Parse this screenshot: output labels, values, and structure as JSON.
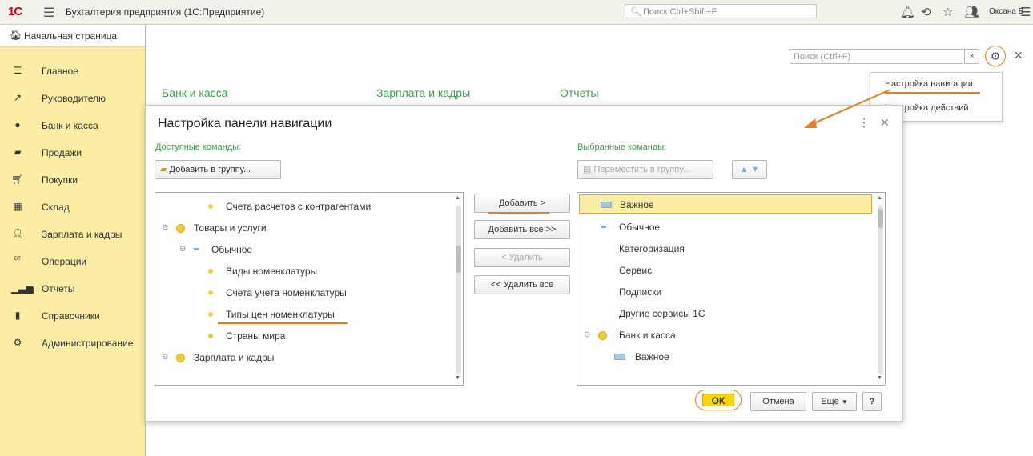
{
  "app": {
    "title": "Бухгалтерия предприятия (1С:Предприятие)",
    "logo": "1С",
    "global_search_placeholder": "Поиск Ctrl+Shift+F",
    "user_name": "Оксана В"
  },
  "sidebar": {
    "home_label": "Начальная страница",
    "items": [
      {
        "label": "Главное",
        "icon": "menu-lines-icon"
      },
      {
        "label": "Руководителю",
        "icon": "chart-line-icon"
      },
      {
        "label": "Банк и касса",
        "icon": "coin-icon"
      },
      {
        "label": "Продажи",
        "icon": "bag-icon"
      },
      {
        "label": "Покупки",
        "icon": "cart-icon"
      },
      {
        "label": "Склад",
        "icon": "warehouse-icon"
      },
      {
        "label": "Зарплата и кадры",
        "icon": "person-icon"
      },
      {
        "label": "Операции",
        "icon": "operations-icon"
      },
      {
        "label": "Отчеты",
        "icon": "bar-chart-icon"
      },
      {
        "label": "Справочники",
        "icon": "book-icon"
      },
      {
        "label": "Администрирование",
        "icon": "gear-icon"
      }
    ]
  },
  "main": {
    "search_placeholder": "Поиск (Ctrl+F)",
    "clear_label": "×",
    "sections": [
      "Банк и касса",
      "Зарплата и кадры",
      "Отчеты"
    ]
  },
  "nav_popup": {
    "items": [
      "Настройка навигации",
      "Настройка действий"
    ]
  },
  "dialog": {
    "title": "Настройка панели навигации",
    "available_caption": "Доступные команды:",
    "selected_caption": "Выбранные команды:",
    "add_to_group_label": "Добавить в группу...",
    "move_to_group_label": "Переместить в группу...",
    "available_tree": [
      {
        "label": "Счета расчетов с контрагентами",
        "level": 2,
        "kind": "dot"
      },
      {
        "label": "Товары и услуги",
        "level": 0,
        "kind": "group"
      },
      {
        "label": "Обычное",
        "level": 1,
        "kind": "subgroup"
      },
      {
        "label": "Виды номенклатуры",
        "level": 2,
        "kind": "dot"
      },
      {
        "label": "Счета учета номенклатуры",
        "level": 2,
        "kind": "dot"
      },
      {
        "label": "Типы цен номенклатуры",
        "level": 2,
        "kind": "dot"
      },
      {
        "label": "Страны мира",
        "level": 2,
        "kind": "dot"
      },
      {
        "label": "Зарплата и кадры",
        "level": 0,
        "kind": "group"
      }
    ],
    "selected_tree": [
      {
        "label": "Важное",
        "kind": "important"
      },
      {
        "label": "Обычное",
        "kind": "normal"
      },
      {
        "label": "Категоризация",
        "kind": "plain"
      },
      {
        "label": "Сервис",
        "kind": "plain"
      },
      {
        "label": "Подписки",
        "kind": "plain"
      },
      {
        "label": "Другие сервисы 1С",
        "kind": "plain"
      },
      {
        "label": "Банк и касса",
        "kind": "group"
      },
      {
        "label": "Важное",
        "kind": "important-sub"
      }
    ],
    "buttons": {
      "add": "Добавить >",
      "add_all": "Добавить все >>",
      "remove": "< Удалить",
      "remove_all": "<< Удалить все",
      "ok": "ОК",
      "cancel": "Отмена",
      "more": "Еще",
      "help": "?"
    }
  },
  "colors": {
    "sidebar_bg": "#fbeda4",
    "accent_green": "#3c9e4c",
    "highlight_orange": "#e87c21",
    "ok_yellow": "#f7d600",
    "selected_row": "#fbeda4"
  }
}
